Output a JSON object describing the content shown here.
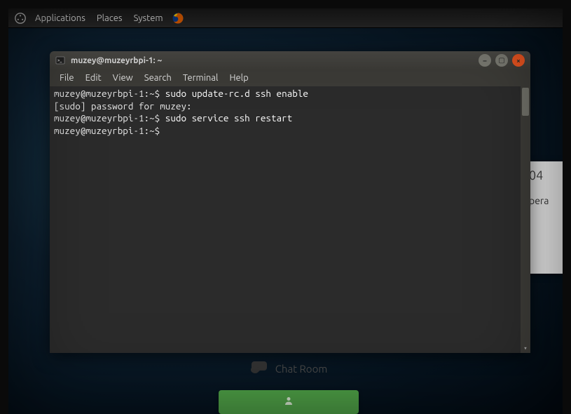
{
  "panel": {
    "applications": "Applications",
    "places": "Places",
    "system": "System"
  },
  "terminal": {
    "title": "muzey@muzeyrbpi-1: ~",
    "menu": {
      "file": "File",
      "edit": "Edit",
      "view": "View",
      "search": "Search",
      "terminal": "Terminal",
      "help": "Help"
    },
    "lines": {
      "l1_prompt": "muzey@muzeyrbpi-1:~$ ",
      "l1_cmd": "sudo update-rc.d ssh enable",
      "l2": "[sudo] password for muzey:",
      "l3_prompt": "muzey@muzeyrbpi-1:~$ ",
      "l3_cmd": "sudo service ssh restart",
      "l4_prompt": "muzey@muzeyrbpi-1:~$"
    }
  },
  "window_controls": {
    "minimize": "–",
    "maximize": "▢",
    "close": "×"
  },
  "background_modal": {
    "partial_number": "04",
    "partial_text": "pera"
  },
  "chat": {
    "label": "Chat Room"
  },
  "colors": {
    "terminal_bg": "#2b2b2b",
    "accent_orange": "#e95420",
    "green_btn": "#52a84a"
  }
}
